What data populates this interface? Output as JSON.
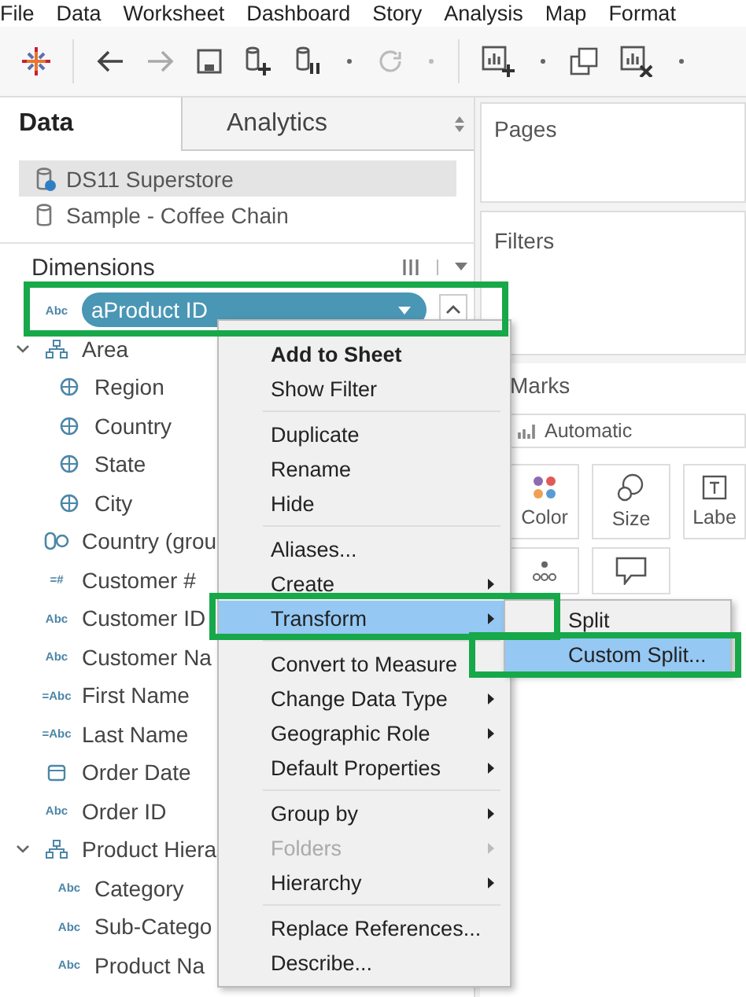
{
  "menu_bar": [
    "File",
    "Data",
    "Worksheet",
    "Dashboard",
    "Story",
    "Analysis",
    "Map",
    "Format"
  ],
  "side_tabs": [
    {
      "label": "Data",
      "selected": true
    },
    {
      "label": "Analytics",
      "selected": false
    }
  ],
  "data_sources": [
    {
      "name": "DS11 Superstore",
      "kind": "extract",
      "selected": true
    },
    {
      "name": "Sample - Coffee Chain",
      "kind": "database",
      "selected": false
    }
  ],
  "dimensions": {
    "title": "Dimensions",
    "fields": [
      {
        "name": "aProduct ID",
        "kind": "text",
        "badge": "Abc",
        "selected": true
      },
      {
        "name": "Area",
        "kind": "hierarchy",
        "selected": false,
        "expanded": true,
        "children": [
          {
            "name": "Region",
            "kind": "geo",
            "selected": false
          },
          {
            "name": "Country",
            "kind": "geo",
            "selected": false
          },
          {
            "name": "State",
            "kind": "geo",
            "selected": false
          },
          {
            "name": "City",
            "kind": "geo",
            "selected": false
          }
        ]
      },
      {
        "name": "Country (grou",
        "kind": "group",
        "selected": false
      },
      {
        "name": "Customer #",
        "kind": "text",
        "badge": "=#",
        "selected": false
      },
      {
        "name": "Customer ID",
        "kind": "text",
        "badge": "Abc",
        "selected": false
      },
      {
        "name": "Customer Na",
        "kind": "text",
        "badge": "Abc",
        "selected": false
      },
      {
        "name": "First Name",
        "kind": "text",
        "badge": "=Abc",
        "selected": false
      },
      {
        "name": "Last Name",
        "kind": "text",
        "badge": "=Abc",
        "selected": false
      },
      {
        "name": "Order Date",
        "kind": "date",
        "selected": false
      },
      {
        "name": "Order ID",
        "kind": "text",
        "badge": "Abc",
        "selected": false
      },
      {
        "name": "Product Hiera",
        "kind": "hierarchy",
        "selected": false,
        "expanded": true,
        "children": [
          {
            "name": "Category",
            "kind": "text",
            "badge": "Abc",
            "selected": false
          },
          {
            "name": "Sub-Catego",
            "kind": "text",
            "badge": "Abc",
            "selected": false
          },
          {
            "name": "Product Na",
            "kind": "text",
            "badge": "Abc",
            "selected": false
          }
        ]
      }
    ]
  },
  "right_panel": {
    "pages_title": "Pages",
    "filters_title": "Filters",
    "marks": {
      "title": "Marks",
      "mark_type": "Automatic",
      "cards": [
        {
          "kind": "color",
          "label": "Color"
        },
        {
          "kind": "size",
          "label": "Size"
        },
        {
          "kind": "label",
          "label": "Labe"
        },
        {
          "kind": "detail"
        },
        {
          "kind": "tooltip"
        }
      ]
    }
  },
  "context_menu": {
    "items": [
      {
        "kind": "item",
        "label": "Add to Sheet",
        "default": true,
        "submenu": false,
        "selected": false,
        "disabled": false
      },
      {
        "kind": "item",
        "label": "Show Filter",
        "default": false,
        "submenu": false,
        "selected": false,
        "disabled": false
      },
      {
        "kind": "separator"
      },
      {
        "kind": "item",
        "label": "Duplicate",
        "default": false,
        "submenu": false,
        "selected": false,
        "disabled": false
      },
      {
        "kind": "item",
        "label": "Rename",
        "default": false,
        "submenu": false,
        "selected": false,
        "disabled": false
      },
      {
        "kind": "item",
        "label": "Hide",
        "default": false,
        "submenu": false,
        "selected": false,
        "disabled": false
      },
      {
        "kind": "separator"
      },
      {
        "kind": "item",
        "label": "Aliases...",
        "default": false,
        "submenu": false,
        "selected": false,
        "disabled": false
      },
      {
        "kind": "item",
        "label": "Create",
        "default": false,
        "submenu": true,
        "selected": false,
        "disabled": false
      },
      {
        "kind": "item",
        "label": "Transform",
        "default": false,
        "submenu": true,
        "selected": true,
        "disabled": false
      },
      {
        "kind": "separator"
      },
      {
        "kind": "item",
        "label": "Convert to Measure",
        "default": false,
        "submenu": false,
        "selected": false,
        "disabled": false
      },
      {
        "kind": "item",
        "label": "Change Data Type",
        "default": false,
        "submenu": true,
        "selected": false,
        "disabled": false
      },
      {
        "kind": "item",
        "label": "Geographic Role",
        "default": false,
        "submenu": true,
        "selected": false,
        "disabled": false
      },
      {
        "kind": "item",
        "label": "Default Properties",
        "default": false,
        "submenu": true,
        "selected": false,
        "disabled": false
      },
      {
        "kind": "separator"
      },
      {
        "kind": "item",
        "label": "Group by",
        "default": false,
        "submenu": true,
        "selected": false,
        "disabled": false
      },
      {
        "kind": "item",
        "label": "Folders",
        "default": false,
        "submenu": true,
        "selected": false,
        "disabled": true
      },
      {
        "kind": "item",
        "label": "Hierarchy",
        "default": false,
        "submenu": true,
        "selected": false,
        "disabled": false
      },
      {
        "kind": "separator"
      },
      {
        "kind": "item",
        "label": "Replace References...",
        "default": false,
        "submenu": false,
        "selected": false,
        "disabled": false
      },
      {
        "kind": "item",
        "label": "Describe...",
        "default": false,
        "submenu": false,
        "selected": false,
        "disabled": false
      }
    ]
  },
  "submenu": {
    "items": [
      {
        "label": "Split",
        "selected": false
      },
      {
        "label": "Custom Split...",
        "selected": true
      }
    ]
  }
}
